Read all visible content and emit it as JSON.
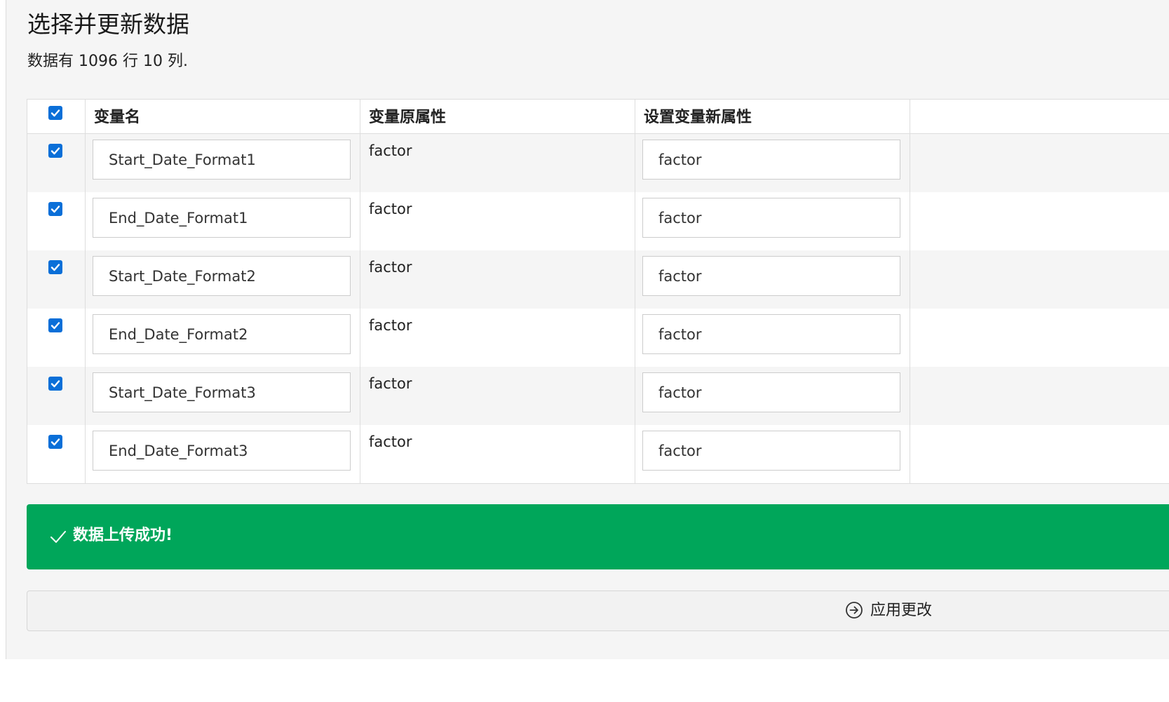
{
  "page": {
    "title": "选择并更新数据",
    "summary": "数据有 1096 行 10 列."
  },
  "table": {
    "headers": {
      "name": "变量名",
      "original": "变量原属性",
      "new": "设置变量新属性"
    },
    "select_all_checked": true,
    "rows": [
      {
        "checked": true,
        "name": "Start_Date_Format1",
        "original": "factor",
        "new": "factor"
      },
      {
        "checked": true,
        "name": "End_Date_Format1",
        "original": "factor",
        "new": "factor"
      },
      {
        "checked": true,
        "name": "Start_Date_Format2",
        "original": "factor",
        "new": "factor"
      },
      {
        "checked": true,
        "name": "End_Date_Format2",
        "original": "factor",
        "new": "factor"
      },
      {
        "checked": true,
        "name": "Start_Date_Format3",
        "original": "factor",
        "new": "factor"
      },
      {
        "checked": true,
        "name": "End_Date_Format3",
        "original": "factor",
        "new": "factor"
      }
    ]
  },
  "alert": {
    "message": "数据上传成功!",
    "icon": "checkmark-icon",
    "color": "#00a65a"
  },
  "actions": {
    "apply_label": "应用更改",
    "apply_icon": "circle-arrow-right-icon"
  },
  "colors": {
    "checkbox": "#0a6fd8",
    "success": "#00a65a"
  }
}
